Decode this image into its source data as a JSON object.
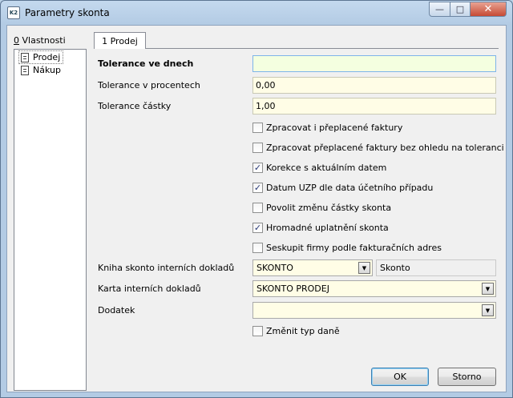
{
  "window": {
    "title": "Parametry skonta",
    "app_icon_text": "K2"
  },
  "left_panel": {
    "label_prefix": "0",
    "label_text": " Vlastnosti",
    "items": [
      {
        "label": "Prodej",
        "selected": true
      },
      {
        "label": "Nákup",
        "selected": false
      }
    ]
  },
  "tab": {
    "label": "1 Prodej"
  },
  "form": {
    "tolerance_days_label": "Tolerance ve dnech",
    "tolerance_days_value": "",
    "tolerance_pct_label": "Tolerance v procentech",
    "tolerance_pct_value": "0,00",
    "tolerance_amount_label": "Tolerance částky",
    "tolerance_amount_value": "1,00",
    "checkboxes": [
      {
        "label": "Zpracovat i přeplacené faktury",
        "checked": false
      },
      {
        "label": "Zpracovat přeplacené faktury bez ohledu na toleranci",
        "checked": false
      },
      {
        "label": "Korekce s aktuálním datem",
        "checked": true
      },
      {
        "label": "Datum UZP dle data účetního případu",
        "checked": true
      },
      {
        "label": "Povolit změnu částky skonta",
        "checked": false
      },
      {
        "label": "Hromadné uplatnění skonta",
        "checked": true
      },
      {
        "label": "Seskupit firmy podle fakturačních adres",
        "checked": false
      }
    ],
    "book_label": "Kniha skonto interních dokladů",
    "book_value": "SKONTO",
    "book_name": "Skonto",
    "card_label": "Karta interních dokladů",
    "card_value": "SKONTO PRODEJ",
    "addendum_label": "Dodatek",
    "addendum_value": "",
    "change_tax_label": "Změnit typ daně",
    "change_tax_checked": false
  },
  "buttons": {
    "ok": "OK",
    "cancel": "Storno"
  },
  "glyphs": {
    "check": "✓",
    "arrow": "▼",
    "min": "—",
    "max": "□",
    "close": "✕"
  }
}
